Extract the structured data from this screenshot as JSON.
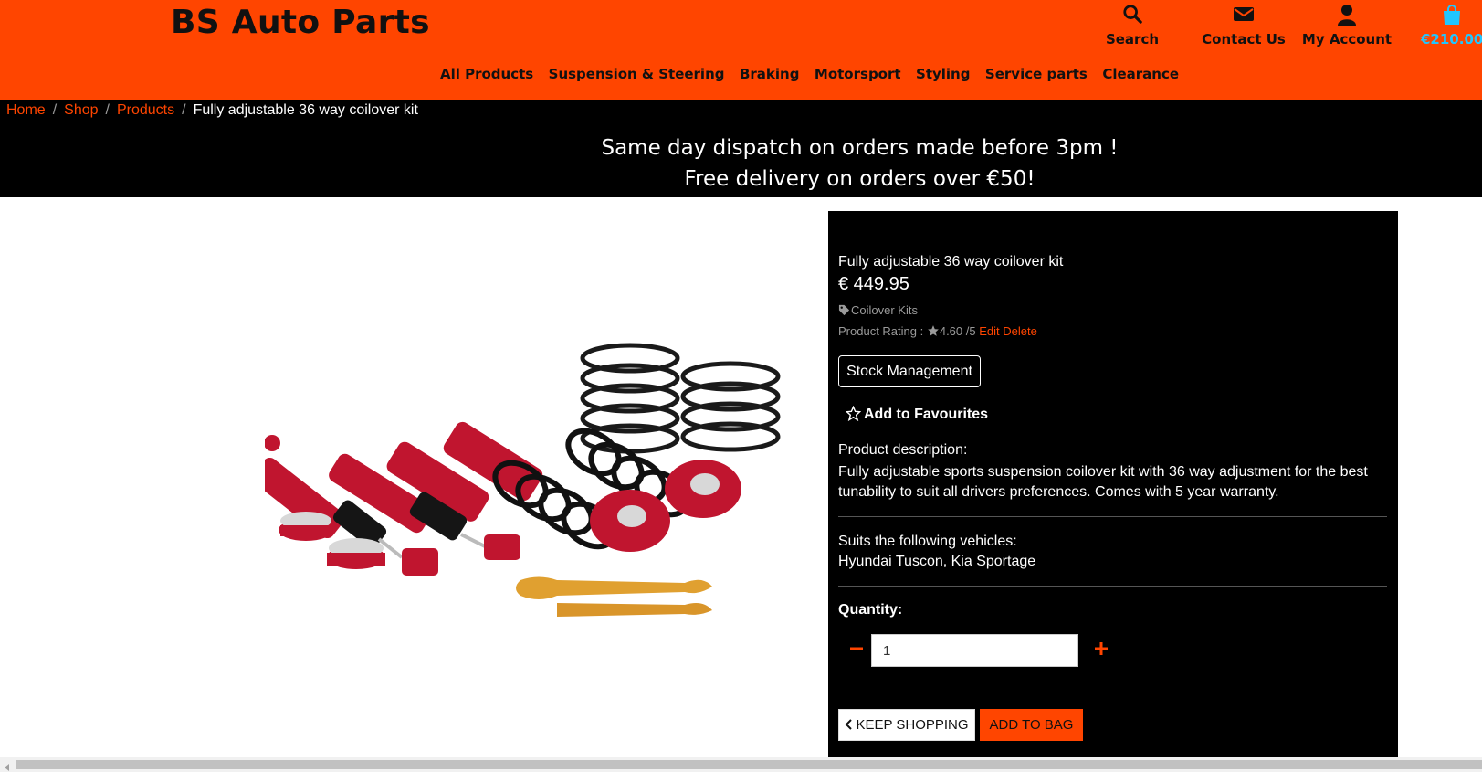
{
  "header": {
    "logo": "BS Auto Parts",
    "search_label": "Search",
    "contact_label": "Contact Us",
    "account_label": "My Account",
    "bag_total": "€210.00"
  },
  "nav": {
    "items": [
      "All Products",
      "Suspension & Steering",
      "Braking",
      "Motorsport",
      "Styling",
      "Service parts",
      "Clearance"
    ]
  },
  "breadcrumb": {
    "home": "Home",
    "shop": "Shop",
    "products": "Products",
    "current": "Fully adjustable 36 way coilover kit"
  },
  "banner": {
    "line1": "Same day dispatch on orders made before 3pm !",
    "line2": "Free delivery on orders over €50!"
  },
  "product": {
    "name": "Fully adjustable 36 way coilover kit",
    "price": "€ 449.95",
    "category": "Coilover Kits",
    "rating_label": "Product Rating :",
    "rating_value": "4.60 /5",
    "edit_label": "Edit",
    "delete_label": "Delete",
    "stock_button": "Stock Management",
    "favourites_label": "Add to Favourites",
    "description_label": "Product description:",
    "description": "Fully adjustable sports suspension coilover kit with 36 way adjustment for the best tunability to suit all drivers preferences. Comes with 5 year warranty.",
    "vehicles_label": "Suits the following vehicles:",
    "vehicles": "Hyundai Tuscon, Kia Sportage",
    "quantity_label": "Quantity:",
    "quantity_value": "1",
    "keep_shopping": "KEEP SHOPPING",
    "add_to_bag": "ADD TO BAG"
  },
  "colors": {
    "brand_orange": "#ff4500",
    "bag_blue": "#21c6ff",
    "panel_black": "#000000",
    "coilover_red": "#c0152f"
  },
  "icons": [
    "search-icon",
    "envelope-icon",
    "user-icon",
    "shopping-bag-icon",
    "tag-icon",
    "star-icon",
    "star-outline-icon",
    "minus-icon",
    "plus-icon",
    "chevron-left-icon"
  ]
}
